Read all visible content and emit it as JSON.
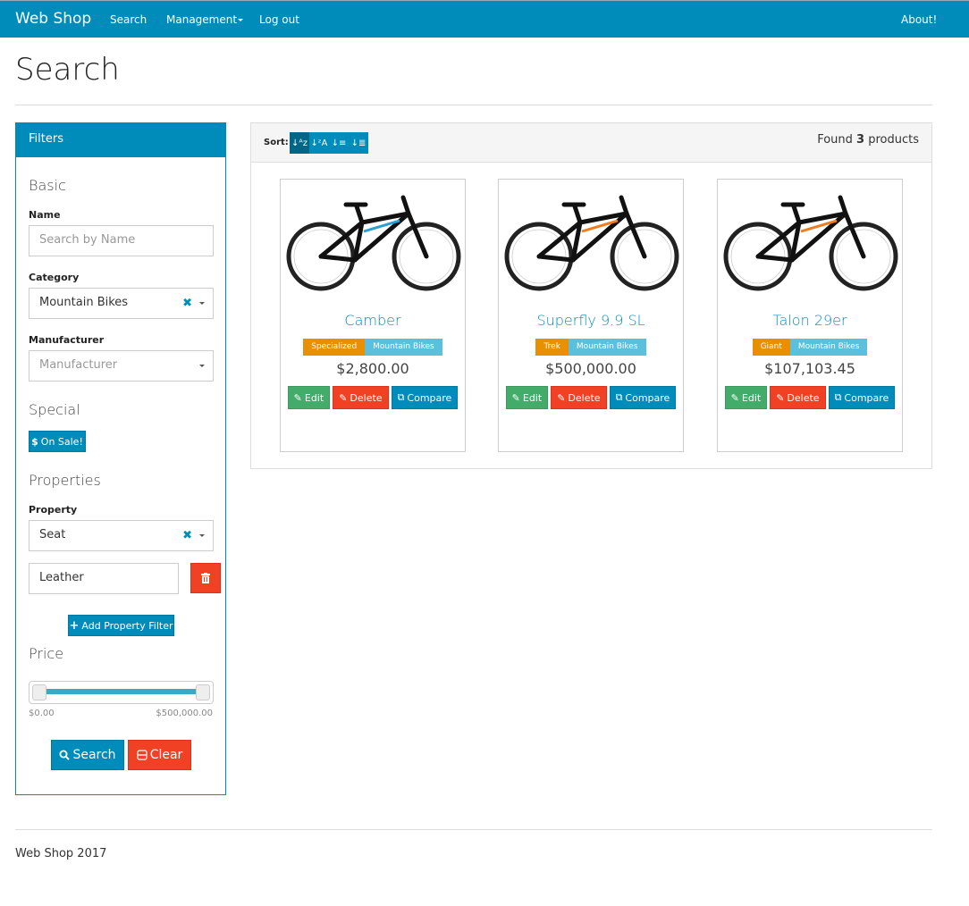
{
  "navbar": {
    "brand": "Web Shop",
    "items": [
      {
        "label": "Search"
      },
      {
        "label": "Management",
        "dropdown": true
      },
      {
        "label": "Log out"
      }
    ],
    "right": "About!"
  },
  "page": {
    "title": "Search"
  },
  "filters": {
    "title": "Filters",
    "basic": {
      "heading": "Basic",
      "name_label": "Name",
      "name_placeholder": "Search by Name",
      "category_label": "Category",
      "category_value": "Mountain Bikes",
      "manufacturer_label": "Manufacturer",
      "manufacturer_placeholder": "Manufacturer"
    },
    "special": {
      "heading": "Special",
      "on_sale_label": "On Sale!",
      "on_sale_icon": "$"
    },
    "properties": {
      "heading": "Properties",
      "property_label": "Property",
      "property_value": "Seat",
      "property_text_value": "Leather",
      "add_label": "Add Property Filter"
    },
    "price": {
      "heading": "Price",
      "min_label": "$0.00",
      "max_label": "$500,000.00",
      "range_low_fraction": 0.0,
      "range_high_fraction": 1.0
    },
    "search_label": "Search",
    "clear_label": "Clear"
  },
  "results": {
    "sort_label": "Sort:",
    "sort_options": [
      "name-asc",
      "name-desc",
      "price-asc",
      "price-desc"
    ],
    "found_prefix": "Found",
    "found_count": "3",
    "found_suffix": "products",
    "products": [
      {
        "name": "Camber",
        "manufacturer": "Specialized",
        "category": "Mountain Bikes",
        "price": "$2,800.00",
        "accent": "#2a9fd6"
      },
      {
        "name": "Superfly 9.9 SL",
        "manufacturer": "Trek",
        "category": "Mountain Bikes",
        "price": "$500,000.00",
        "accent": "#f07c1e"
      },
      {
        "name": "Talon 29er",
        "manufacturer": "Giant",
        "category": "Mountain Bikes",
        "price": "$107,103.45",
        "accent": "#f07c1e"
      }
    ],
    "edit_label": "Edit",
    "delete_label": "Delete",
    "compare_label": "Compare"
  },
  "footer": {
    "text": "Web Shop 2017"
  }
}
